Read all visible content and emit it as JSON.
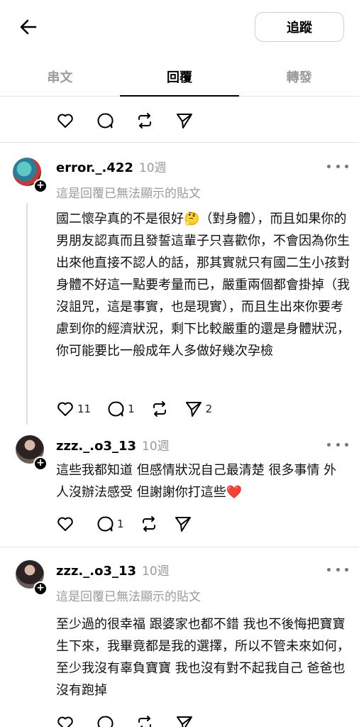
{
  "header": {
    "follow_label": "追蹤"
  },
  "tabs": [
    {
      "label": "串文",
      "active": false
    },
    {
      "label": "回覆",
      "active": true
    },
    {
      "label": "轉發",
      "active": false
    }
  ],
  "top_actions": {
    "like": "",
    "reply": "",
    "repost": "",
    "share": ""
  },
  "posts": [
    {
      "username": "error._.422",
      "time": "10週",
      "unavailable": "這是回覆已無法顯示的貼文",
      "text": "國二懷孕真的不是很好🤔（對身體），而且如果你的男朋友認真而且發誓這輩子只喜歡你，不會因為你生出來他直接不認人的話，那其實就只有國二生小孩對身體不好這一點要考量而已，嚴重兩個都會掛掉（我沒詛咒，這是事實，也是現實），而且生出來你要考慮到你的經濟狀況，剩下比較嚴重的還是身體狀況，你可能要比一般成年人多做好幾次孕檢",
      "likes": "11",
      "replies": "1",
      "shares": "2"
    },
    {
      "username": "zzz._.o3_13",
      "time": "10週",
      "text": "這些我都知道 但感情狀況自己最清楚 很多事情 外人沒辦法感受 但謝謝你打這些❤️",
      "replies": "1"
    },
    {
      "username": "zzz._.o3_13",
      "time": "10週",
      "unavailable": "這是回覆已無法顯示的貼文",
      "text": "至少過的很幸福 跟婆家也都不錯 我也不後悔把寶寶生下來，我畢竟都是我的選擇，所以不管未來如何，至少我沒有辜負寶寶 我也沒有對不起我自己 爸爸也沒有跑掉"
    }
  ],
  "colors": {
    "muted": "#9a9a9a",
    "heart": "#e0245e"
  }
}
